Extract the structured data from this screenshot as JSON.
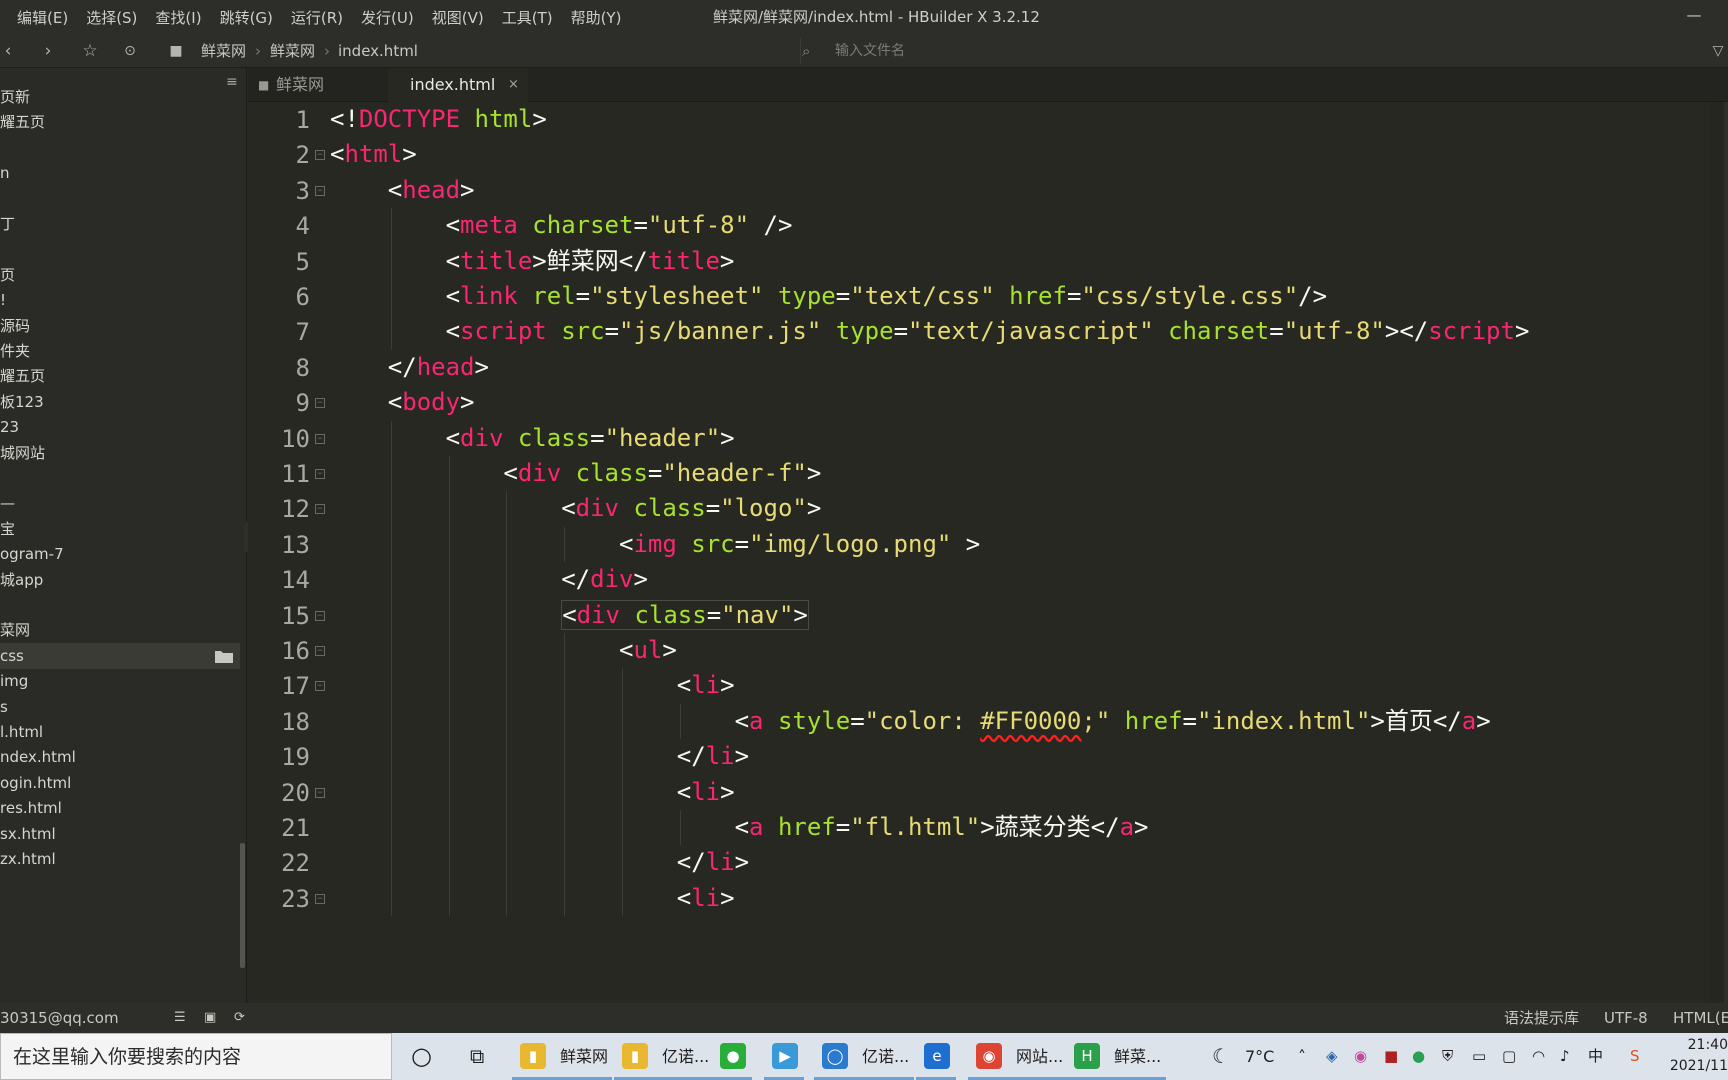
{
  "menubar": {
    "items": [
      "编辑(E)",
      "选择(S)",
      "查找(I)",
      "跳转(G)",
      "运行(R)",
      "发行(U)",
      "视图(V)",
      "工具(T)",
      "帮助(Y)"
    ],
    "title": "鲜菜网/鲜菜网/index.html - HBuilder X 3.2.12",
    "minimize": "—"
  },
  "toolbar": {
    "breadcrumb": [
      "鲜菜网",
      "鲜菜网",
      "index.html"
    ],
    "search_placeholder": "输入文件名"
  },
  "sidebar": {
    "items": [
      "页新",
      "耀五页",
      "",
      "n",
      "",
      "丁",
      "",
      "页",
      "!",
      "源码",
      "件夹",
      "耀五页",
      "板123",
      "23",
      "城网站",
      "",
      "—",
      "宝",
      "ogram-7",
      "城app",
      "",
      "菜网",
      "css",
      "img",
      "s",
      "l.html",
      "ndex.html",
      "ogin.html",
      "res.html",
      "sx.html",
      "zx.html"
    ],
    "selected_index": 22
  },
  "tabs": [
    {
      "label": "鲜菜网",
      "active": false
    },
    {
      "label": "index.html",
      "active": true,
      "close": "×"
    }
  ],
  "editor": {
    "lines": [
      [
        [
          "pl",
          "<!"
        ],
        [
          "tg",
          "DOCTYPE"
        ],
        [
          "pl",
          " "
        ],
        [
          "at",
          "html"
        ],
        [
          "pl",
          ">"
        ]
      ],
      [
        [
          "pl",
          "<"
        ],
        [
          "tg",
          "html"
        ],
        [
          "pl",
          ">"
        ]
      ],
      [
        [
          "pl",
          "    <"
        ],
        [
          "tg",
          "head"
        ],
        [
          "pl",
          ">"
        ]
      ],
      [
        [
          "pl",
          "        <"
        ],
        [
          "tg",
          "meta"
        ],
        [
          "pl",
          " "
        ],
        [
          "at",
          "charset"
        ],
        [
          "pl",
          "="
        ],
        [
          "st",
          "\"utf-8\""
        ],
        [
          "pl",
          " />"
        ]
      ],
      [
        [
          "pl",
          "        <"
        ],
        [
          "tg",
          "title"
        ],
        [
          "pl",
          ">鲜菜网</"
        ],
        [
          "tg",
          "title"
        ],
        [
          "pl",
          ">"
        ]
      ],
      [
        [
          "pl",
          "        <"
        ],
        [
          "tg",
          "link"
        ],
        [
          "pl",
          " "
        ],
        [
          "at",
          "rel"
        ],
        [
          "pl",
          "="
        ],
        [
          "st",
          "\"stylesheet\""
        ],
        [
          "pl",
          " "
        ],
        [
          "at",
          "type"
        ],
        [
          "pl",
          "="
        ],
        [
          "st",
          "\"text/css\""
        ],
        [
          "pl",
          " "
        ],
        [
          "at",
          "href"
        ],
        [
          "pl",
          "="
        ],
        [
          "st",
          "\"css/style.css\""
        ],
        [
          "pl",
          "/>"
        ]
      ],
      [
        [
          "pl",
          "        <"
        ],
        [
          "tg",
          "script"
        ],
        [
          "pl",
          " "
        ],
        [
          "at",
          "src"
        ],
        [
          "pl",
          "="
        ],
        [
          "st",
          "\"js/banner.js\""
        ],
        [
          "pl",
          " "
        ],
        [
          "at",
          "type"
        ],
        [
          "pl",
          "="
        ],
        [
          "st",
          "\"text/javascript\""
        ],
        [
          "pl",
          " "
        ],
        [
          "at",
          "charset"
        ],
        [
          "pl",
          "="
        ],
        [
          "st",
          "\"utf-8\""
        ],
        [
          "pl",
          "></"
        ],
        [
          "tg",
          "script"
        ],
        [
          "pl",
          ">"
        ]
      ],
      [
        [
          "pl",
          "    </"
        ],
        [
          "tg",
          "head"
        ],
        [
          "pl",
          ">"
        ]
      ],
      [
        [
          "pl",
          "    <"
        ],
        [
          "tg",
          "body"
        ],
        [
          "pl",
          ">"
        ]
      ],
      [
        [
          "pl",
          "        <"
        ],
        [
          "tg",
          "div"
        ],
        [
          "pl",
          " "
        ],
        [
          "at",
          "class"
        ],
        [
          "pl",
          "="
        ],
        [
          "st",
          "\"header\""
        ],
        [
          "pl",
          ">"
        ]
      ],
      [
        [
          "pl",
          "            <"
        ],
        [
          "tg",
          "div"
        ],
        [
          "pl",
          " "
        ],
        [
          "at",
          "class"
        ],
        [
          "pl",
          "="
        ],
        [
          "st",
          "\"header-f\""
        ],
        [
          "pl",
          ">"
        ]
      ],
      [
        [
          "pl",
          "                <"
        ],
        [
          "tg",
          "div"
        ],
        [
          "pl",
          " "
        ],
        [
          "at",
          "class"
        ],
        [
          "pl",
          "="
        ],
        [
          "st",
          "\"logo\""
        ],
        [
          "pl",
          ">"
        ]
      ],
      [
        [
          "pl",
          "                    <"
        ],
        [
          "tg",
          "img"
        ],
        [
          "pl",
          " "
        ],
        [
          "at",
          "src"
        ],
        [
          "pl",
          "="
        ],
        [
          "st",
          "\"img/logo.png\""
        ],
        [
          "pl",
          " >"
        ]
      ],
      [
        [
          "pl",
          "                </"
        ],
        [
          "tg",
          "div"
        ],
        [
          "pl",
          ">"
        ]
      ],
      [
        [
          "pl",
          "                "
        ],
        [
          "hl",
          "<"
        ],
        [
          "tg",
          "div"
        ],
        [
          "pl",
          " "
        ],
        [
          "at",
          "class"
        ],
        [
          "pl",
          "="
        ],
        [
          "st",
          "\"nav\""
        ],
        [
          "hlend",
          ">"
        ]
      ],
      [
        [
          "pl",
          "                    <"
        ],
        [
          "tg",
          "ul"
        ],
        [
          "pl",
          ">"
        ]
      ],
      [
        [
          "pl",
          "                        <"
        ],
        [
          "tg",
          "li"
        ],
        [
          "pl",
          ">"
        ]
      ],
      [
        [
          "pl",
          "                            <"
        ],
        [
          "tg",
          "a"
        ],
        [
          "pl",
          " "
        ],
        [
          "at",
          "style"
        ],
        [
          "pl",
          "="
        ],
        [
          "st",
          "\"color: "
        ],
        [
          "sq",
          "#FF0000"
        ],
        [
          "st",
          ";\""
        ],
        [
          "pl",
          " "
        ],
        [
          "at",
          "href"
        ],
        [
          "pl",
          "="
        ],
        [
          "st",
          "\"index.html\""
        ],
        [
          "pl",
          ">首页</"
        ],
        [
          "tg",
          "a"
        ],
        [
          "pl",
          ">"
        ]
      ],
      [
        [
          "pl",
          "                        </"
        ],
        [
          "tg",
          "li"
        ],
        [
          "pl",
          ">"
        ]
      ],
      [
        [
          "pl",
          "                        <"
        ],
        [
          "tg",
          "li"
        ],
        [
          "pl",
          ">"
        ]
      ],
      [
        [
          "pl",
          "                            <"
        ],
        [
          "tg",
          "a"
        ],
        [
          "pl",
          " "
        ],
        [
          "at",
          "href"
        ],
        [
          "pl",
          "="
        ],
        [
          "st",
          "\"fl.html\""
        ],
        [
          "pl",
          ">蔬菜分类</"
        ],
        [
          "tg",
          "a"
        ],
        [
          "pl",
          ">"
        ]
      ],
      [
        [
          "pl",
          "                        </"
        ],
        [
          "tg",
          "li"
        ],
        [
          "pl",
          ">"
        ]
      ],
      [
        [
          "pl",
          "                        <"
        ],
        [
          "tg",
          "li"
        ],
        [
          "pl",
          ">"
        ]
      ]
    ],
    "line_numbers": [
      "1",
      "2",
      "3",
      "4",
      "5",
      "6",
      "7",
      "8",
      "9",
      "10",
      "11",
      "12",
      "13",
      "14",
      "15",
      "16",
      "17",
      "18",
      "19",
      "20",
      "21",
      "22",
      "23"
    ],
    "foldable": [
      2,
      3,
      9,
      10,
      11,
      12,
      15,
      16,
      17,
      20,
      23
    ]
  },
  "statusbar": {
    "account": "30315@qq.com",
    "syntax_hint": "语法提示库",
    "encoding": "UTF-8",
    "language": "HTML(E"
  },
  "taskbar": {
    "search_placeholder": "在这里输入你要搜索的内容",
    "apps": [
      {
        "label": "鲜菜网",
        "icon": "folder-icon"
      },
      {
        "label": "亿诺...",
        "icon": "folder-icon"
      },
      {
        "label": "",
        "icon": "wechat-icon"
      },
      {
        "label": "",
        "icon": "media-player-icon"
      },
      {
        "label": "亿诺...",
        "icon": "chat-icon"
      },
      {
        "label": "",
        "icon": "edge-icon"
      },
      {
        "label": "网站...",
        "icon": "chrome-icon"
      },
      {
        "label": "鲜菜...",
        "icon": "hbuilder-icon"
      }
    ],
    "weather": "7°C",
    "time": "21:40",
    "date": "2021/11"
  },
  "colors": {
    "tag": "#f92672",
    "attr": "#a6e22e",
    "string": "#e6db74",
    "plain": "#f8f8f2",
    "background": "#272822"
  }
}
